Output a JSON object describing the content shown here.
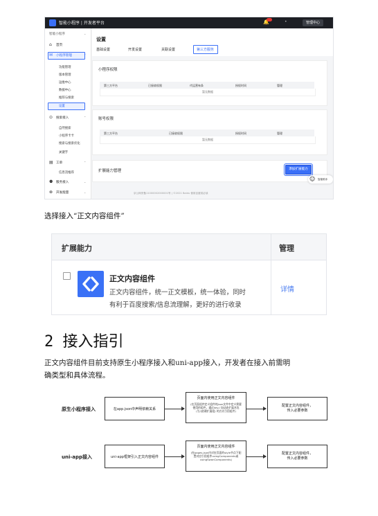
{
  "screenshot": {
    "brand": "智能小程序 | 开发者平台",
    "console": "管理中心",
    "side_top": "智能小程序",
    "side_items": {
      "home": "首页",
      "manage": "小程序管理",
      "func": "功能管理",
      "version": "版本管理",
      "ops": "运维中心",
      "data": "数据中心",
      "push": "推荐与搜索",
      "settings": "设置",
      "search": "搜索接入",
      "natural": "自然搜索",
      "card": "小程序卡卡",
      "web": "搜索与搜索优化",
      "keyword": "关键字",
      "ticket": "工单",
      "ticket_sub": "信息流推荐",
      "service": "服务接入",
      "bottom": "开发能量"
    },
    "page_title": "设置",
    "tabs": [
      "基础设置",
      "开发设置",
      "关联设置",
      "第三方服务"
    ],
    "section1": {
      "title": "小程序权限",
      "cols": [
        "第三方平台",
        "已接收权限",
        "代运营有条",
        "授权时间",
        "管理"
      ],
      "empty": "暂无数据"
    },
    "section2": {
      "title": "账号权限",
      "cols": [
        "第三方平台",
        "已接收权限",
        "授权时间",
        "管理"
      ],
      "empty": "暂无数据"
    },
    "section3": {
      "title": "扩展能力管理",
      "button": "添加扩展能力"
    },
    "helper": "智能助手",
    "footer": "京公网安备11000002000001号 | ©2021 Baidu 使用百度前必读"
  },
  "caption": "选择接入“正文内容组件”",
  "ext_table": {
    "col_ability": "扩展能力",
    "col_manage": "管理",
    "component_name": "正文内容组件",
    "desc_line1": "正文内容组件，统一正文模板，统一体验，同时",
    "desc_line2": "有利于百度搜索/信息流理解，更好的进行收录",
    "detail_link": "详情",
    "checkbox_checked": false,
    "brand_color": "#3A71F6"
  },
  "section_heading": "2 接入指引",
  "paragraph_line1": "正文内容组件目前支持原生小程序接入和uni-app接入，开发者在接入前需明",
  "paragraph_line2": "确类型和具体流程。",
  "flow": {
    "row1": {
      "label": "原生小程序接入",
      "step1": "在app.json中声明依赖关系",
      "step2_title": "页面内使用正文内容组件",
      "step2_note": "(在页面组件定义组件的json文件中定义需要使用的组件，通过key:/ 加动态扩展名包(引/(依赖扩展组) 的方式引用组件)",
      "step3": "配置正文内容组件，\n传入必要参数"
    },
    "row2": {
      "label": "uni-app接入",
      "step1": "uni-app框架引入正文内容组件",
      "step2_title": "页面内使用正文内容组件",
      "step2_note": "(在pages.json内对应页面的style节点下配置对应引用组件usingComponents或usingSwanComponents)",
      "step3": "配置正文内容组件，\n传入必要参数"
    }
  }
}
